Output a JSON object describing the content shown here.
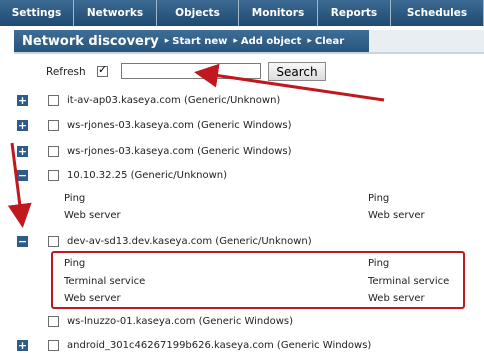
{
  "nav": {
    "tabs": [
      {
        "label": "Settings"
      },
      {
        "label": "Networks"
      },
      {
        "label": "Objects"
      },
      {
        "label": "Monitors"
      },
      {
        "label": "Reports"
      },
      {
        "label": "Schedules"
      }
    ]
  },
  "header": {
    "title": "Network discovery",
    "actions": [
      {
        "label": "Start new"
      },
      {
        "label": "Add object"
      },
      {
        "label": "Clear"
      }
    ]
  },
  "refresh": {
    "label": "Refresh",
    "checked": true,
    "search_value": "",
    "search_button": "Search"
  },
  "hosts": [
    {
      "label": "it-av-ap03.kaseya.com (Generic/Unknown)",
      "expanded": false
    },
    {
      "label": "ws-rjones-03.kaseya.com (Generic Windows)",
      "expanded": false
    },
    {
      "label": "ws-rjones-03.kaseya.com (Generic Windows)",
      "expanded": false
    },
    {
      "label": "10.10.32.25 (Generic/Unknown)",
      "expanded": true,
      "services": [
        {
          "left": "Ping",
          "right": "Ping"
        },
        {
          "left": "Web server",
          "right": "Web server"
        }
      ]
    },
    {
      "label": "dev-av-sd13.dev.kaseya.com (Generic/Unknown)",
      "expanded": true,
      "services": [
        {
          "left": "Ping",
          "right": "Ping"
        },
        {
          "left": "Terminal service",
          "right": "Terminal service"
        },
        {
          "left": "Web server",
          "right": "Web server"
        }
      ]
    },
    {
      "label": "ws-lnuzzo-01.kaseya.com (Generic Windows)",
      "expanded": false
    },
    {
      "label": "android_301c46267199b626.kaseya.com (Generic Windows)",
      "expanded": false
    }
  ],
  "colors": {
    "nav_bg": "#2d5c8a",
    "annotation_red": "#c0181e",
    "toggle_bg": "#2d5c8a"
  },
  "icons": {
    "expand": "+",
    "collapse": "−",
    "arrow": "▸"
  }
}
